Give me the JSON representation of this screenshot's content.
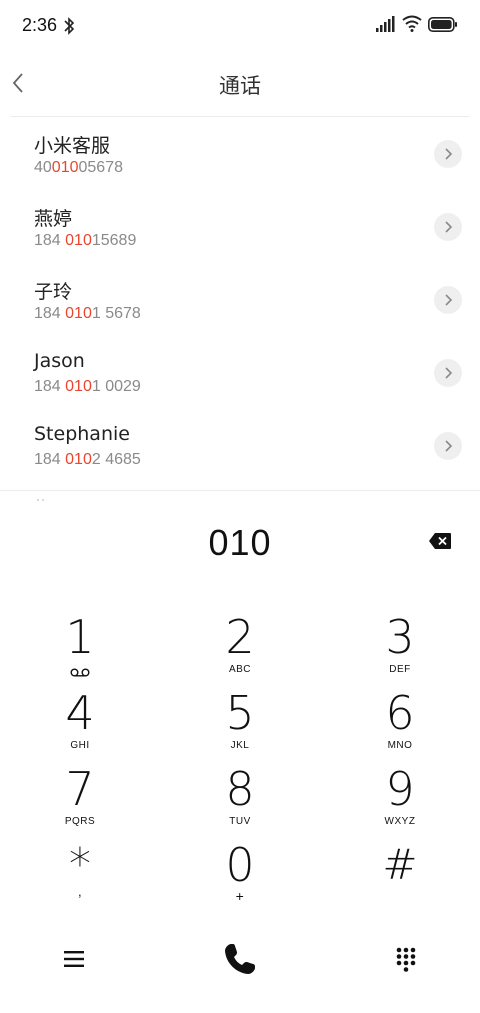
{
  "status_bar": {
    "time": "2:36",
    "icons": [
      "bluetooth-icon",
      "signal-icon",
      "wifi-icon",
      "battery-icon"
    ]
  },
  "header": {
    "title": "通话",
    "back_icon": "chevron-left-icon"
  },
  "contacts": [
    {
      "name": "小米客服",
      "number_pre": "40",
      "number_match": "010",
      "number_post": "05678"
    },
    {
      "name": "燕婷",
      "number_pre": "184 ",
      "number_match": "010",
      "number_post": "15689"
    },
    {
      "name": "子玲",
      "number_pre": "184 ",
      "number_match": "010",
      "number_post": "1 5678"
    },
    {
      "name": "Jason",
      "number_pre": "184 ",
      "number_match": "010",
      "number_post": "1 0029"
    },
    {
      "name": "Stephanie",
      "number_pre": "184 ",
      "number_match": "010",
      "number_post": "2 4685"
    }
  ],
  "dialer": {
    "input_value": "010"
  },
  "keypad": {
    "keys": [
      {
        "digit": "1",
        "letters": ""
      },
      {
        "digit": "2",
        "letters": "ABC"
      },
      {
        "digit": "3",
        "letters": "DEF"
      },
      {
        "digit": "4",
        "letters": "GHI"
      },
      {
        "digit": "5",
        "letters": "JKL"
      },
      {
        "digit": "6",
        "letters": "MNO"
      },
      {
        "digit": "7",
        "letters": "PQRS"
      },
      {
        "digit": "8",
        "letters": "TUV"
      },
      {
        "digit": "9",
        "letters": "WXYZ"
      },
      {
        "digit": "*",
        "letters": ","
      },
      {
        "digit": "0",
        "letters": "+"
      },
      {
        "digit": "#",
        "letters": ""
      }
    ]
  },
  "colors": {
    "match_highlight": "#e8462e",
    "number_gray": "#8a8a8a",
    "chevron_bg": "#efefef"
  }
}
